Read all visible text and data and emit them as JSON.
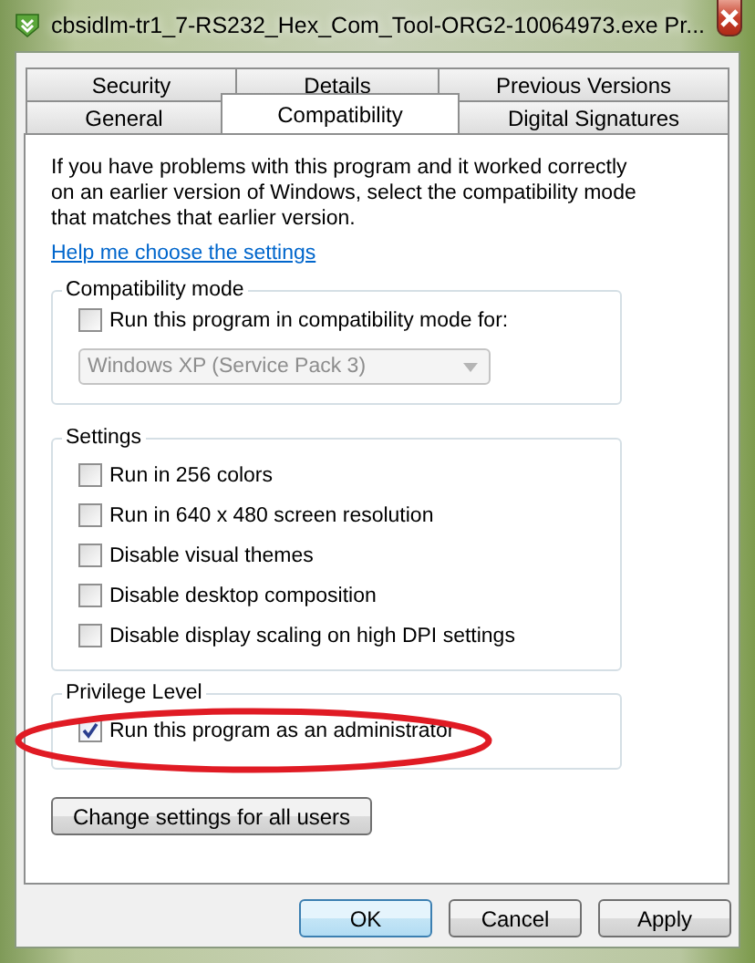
{
  "window": {
    "title": "cbsidlm-tr1_7-RS232_Hex_Com_Tool-ORG2-10064973.exe Pr..."
  },
  "tab_rows": [
    [
      {
        "label": "Security",
        "selected": false
      },
      {
        "label": "Details",
        "selected": false
      },
      {
        "label": "Previous Versions",
        "selected": false
      }
    ],
    [
      {
        "label": "General",
        "selected": false
      },
      {
        "label": "Compatibility",
        "selected": true
      },
      {
        "label": "Digital Signatures",
        "selected": false
      }
    ]
  ],
  "intro": "If you have problems with this program and it worked correctly on an earlier version of Windows, select the compatibility mode that matches that earlier version.",
  "help_link": "Help me choose the settings",
  "compatibility_mode": {
    "title": "Compatibility mode",
    "checkbox": {
      "label": "Run this program in compatibility mode for:",
      "checked": false
    },
    "dropdown": {
      "value": "Windows XP (Service Pack 3)",
      "disabled": true
    }
  },
  "settings": {
    "title": "Settings",
    "options": [
      {
        "label": "Run in 256 colors",
        "checked": false
      },
      {
        "label": "Run in 640 x 480 screen resolution",
        "checked": false
      },
      {
        "label": "Disable visual themes",
        "checked": false
      },
      {
        "label": "Disable desktop composition",
        "checked": false
      },
      {
        "label": "Disable display scaling on high DPI settings",
        "checked": false
      }
    ]
  },
  "privilege_level": {
    "title": "Privilege Level",
    "options": [
      {
        "label": "Run this program as an administrator",
        "checked": true
      }
    ]
  },
  "change_button": "Change settings for all users",
  "buttons": [
    {
      "label": "OK",
      "default": true
    },
    {
      "label": "Cancel",
      "default": false
    },
    {
      "label": "Apply",
      "default": false
    }
  ]
}
